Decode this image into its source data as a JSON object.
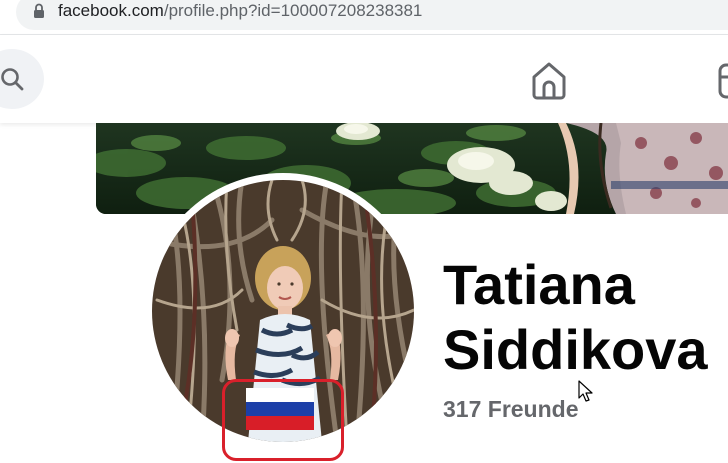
{
  "browser": {
    "url_host": "facebook.com",
    "url_path": "/profile.php?id=100007208238381"
  },
  "nav": {
    "icons": [
      "search-icon",
      "home-icon",
      "watch-icon"
    ]
  },
  "profile": {
    "name_first": "Tatiana",
    "name_last": "Siddikova",
    "friends": "317 Freunde"
  },
  "colors": {
    "highlight": "#d9202b",
    "name_text": "#050505",
    "secondary_text": "#65676b",
    "flag_white": "#ffffff",
    "flag_blue": "#1c3fa8",
    "flag_red": "#d81e28"
  }
}
